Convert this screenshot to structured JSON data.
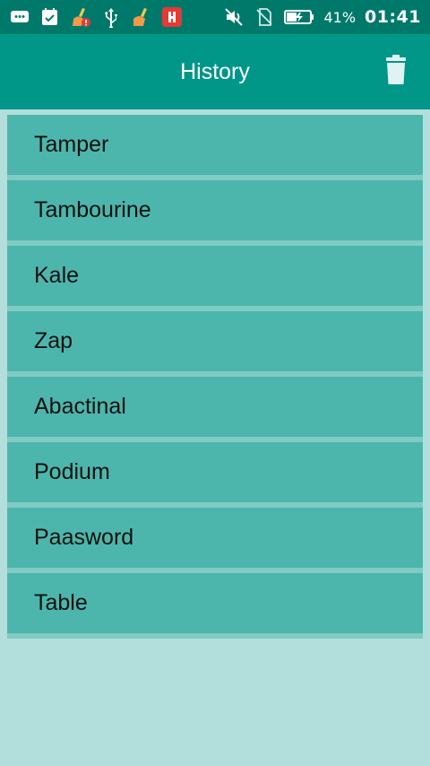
{
  "status_bar": {
    "left_icons": [
      "chat-bubble-icon",
      "calendar-check-icon",
      "cleaner-alert-icon",
      "usb-icon",
      "cleaner-icon",
      "app-red-icon"
    ],
    "right_icons": [
      "mute-icon",
      "no-sim-icon",
      "battery-charging-icon"
    ],
    "battery_percent": "41%",
    "time": "01:41"
  },
  "app_bar": {
    "title": "History",
    "delete_icon": "trash-icon"
  },
  "history": {
    "items": [
      {
        "label": "Tamper"
      },
      {
        "label": "Tambourine"
      },
      {
        "label": "Kale"
      },
      {
        "label": "Zap"
      },
      {
        "label": "Abactinal"
      },
      {
        "label": "Podium"
      },
      {
        "label": "Paasword"
      },
      {
        "label": "Table"
      }
    ]
  },
  "colors": {
    "status_bar": "#00796b",
    "app_bar": "#009688",
    "list_item": "#4db6ac",
    "background": "#b2dfdb"
  }
}
